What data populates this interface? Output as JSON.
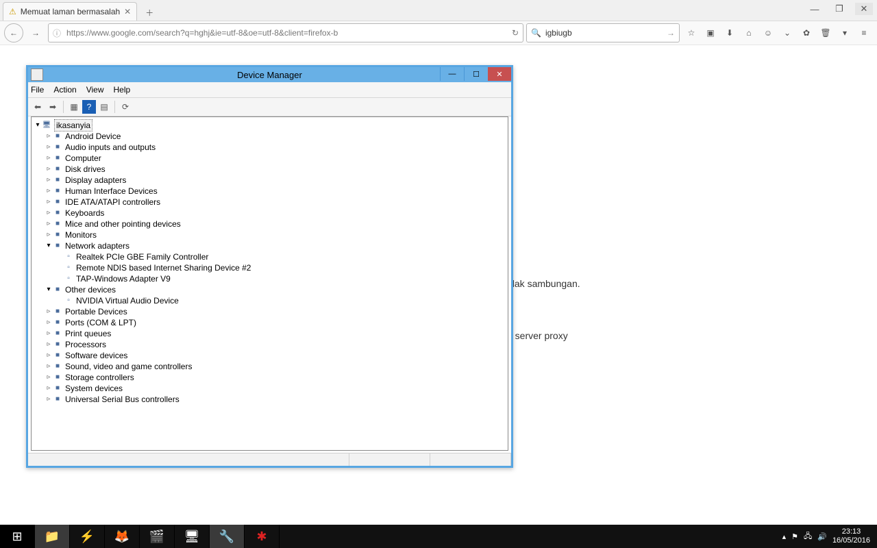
{
  "browser": {
    "tab_title": "Memuat laman bermasalah",
    "url": "https://www.google.com/search?q=hghj&ie=utf-8&oe=utf-8&client=firefox-b",
    "search_value": "igbiugb"
  },
  "page_behind": {
    "line1": "olak sambungan.",
    "line2": "n server proxy"
  },
  "device_manager": {
    "title": "Device Manager",
    "menu": [
      "File",
      "Action",
      "View",
      "Help"
    ],
    "root": "ikasanyia",
    "categories": [
      {
        "label": "Android Device",
        "expanded": false
      },
      {
        "label": "Audio inputs and outputs",
        "expanded": false
      },
      {
        "label": "Computer",
        "expanded": false
      },
      {
        "label": "Disk drives",
        "expanded": false
      },
      {
        "label": "Display adapters",
        "expanded": false
      },
      {
        "label": "Human Interface Devices",
        "expanded": false
      },
      {
        "label": "IDE ATA/ATAPI controllers",
        "expanded": false
      },
      {
        "label": "Keyboards",
        "expanded": false
      },
      {
        "label": "Mice and other pointing devices",
        "expanded": false
      },
      {
        "label": "Monitors",
        "expanded": false
      },
      {
        "label": "Network adapters",
        "expanded": true,
        "children": [
          {
            "label": "Realtek PCIe GBE Family Controller"
          },
          {
            "label": "Remote NDIS based Internet Sharing Device #2"
          },
          {
            "label": "TAP-Windows Adapter V9"
          }
        ]
      },
      {
        "label": "Other devices",
        "expanded": true,
        "children": [
          {
            "label": "NVIDIA Virtual Audio Device"
          }
        ]
      },
      {
        "label": "Portable Devices",
        "expanded": false
      },
      {
        "label": "Ports (COM & LPT)",
        "expanded": false
      },
      {
        "label": "Print queues",
        "expanded": false
      },
      {
        "label": "Processors",
        "expanded": false
      },
      {
        "label": "Software devices",
        "expanded": false
      },
      {
        "label": "Sound, video and game controllers",
        "expanded": false
      },
      {
        "label": "Storage controllers",
        "expanded": false
      },
      {
        "label": "System devices",
        "expanded": false
      },
      {
        "label": "Universal Serial Bus controllers",
        "expanded": false
      }
    ]
  },
  "systray": {
    "time": "23:13",
    "date": "16/05/2016"
  }
}
